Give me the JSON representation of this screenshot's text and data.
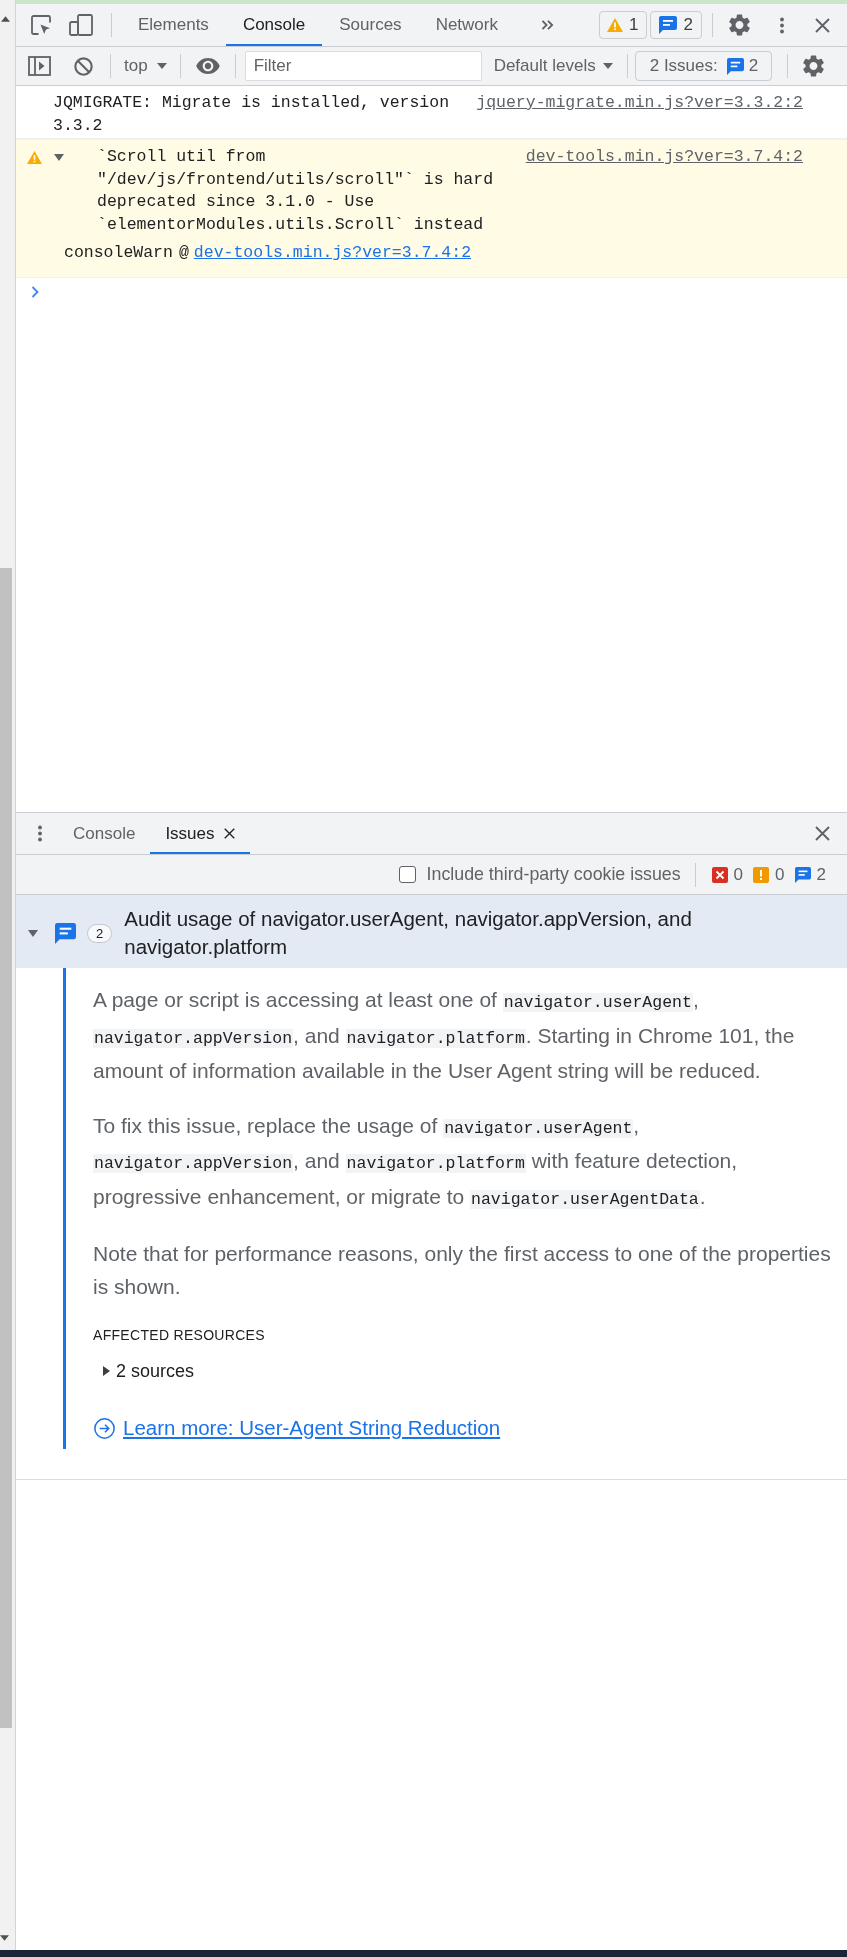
{
  "top_toolbar": {
    "tabs": [
      {
        "label": "Elements",
        "selected": false
      },
      {
        "label": "Console",
        "selected": true
      },
      {
        "label": "Sources",
        "selected": false
      },
      {
        "label": "Network",
        "selected": false
      }
    ],
    "warning_count": "1",
    "message_count": "2"
  },
  "console_toolbar": {
    "context": "top",
    "filter": {
      "placeholder": "Filter"
    },
    "levels": "Default levels",
    "issues_label": "2 Issues:",
    "issues_count": "2"
  },
  "messages": [
    {
      "kind": "log",
      "text": "JQMIGRATE: Migrate is installed, version 3.3.2",
      "source": "jquery-migrate.min.js?ver=3.3.2:2"
    },
    {
      "kind": "warning",
      "expanded": true,
      "text": "`Scroll util from \"/dev/js/frontend/utils/scroll\"` is hard deprecated since 3.1.0 - Use `elementorModules.utils.Scroll` instead",
      "source": "dev-tools.min.js?ver=3.7.4:2",
      "stack": [
        {
          "function": "consoleWarn",
          "separator": "@",
          "source": "dev-tools.min.js?ver=3.7.4:2"
        }
      ]
    }
  ],
  "drawer": {
    "tabs": [
      {
        "label": "Console",
        "selected": false,
        "closable": false
      },
      {
        "label": "Issues",
        "selected": true,
        "closable": true
      }
    ],
    "include_third_party": {
      "label": "Include third-party cookie issues",
      "checked": false
    },
    "counts": [
      {
        "kind": "error",
        "count": "0"
      },
      {
        "kind": "warning",
        "count": "0"
      },
      {
        "kind": "info",
        "count": "2"
      }
    ],
    "issues": [
      {
        "kind": "info",
        "count": "2",
        "title": "Audit usage of navigator.userAgent, navigator.appVersion, and navigator.platform",
        "expanded": true,
        "paragraphs": [
          {
            "segments": [
              {
                "kind": "text",
                "text": "A page or script is accessing at least one of "
              },
              {
                "kind": "code",
                "text": "navigator.userAgent"
              },
              {
                "kind": "text",
                "text": ", "
              },
              {
                "kind": "code",
                "text": "navigator.appVersion"
              },
              {
                "kind": "text",
                "text": ", and "
              },
              {
                "kind": "code",
                "text": "navigator.platform"
              },
              {
                "kind": "text",
                "text": ". Starting in Chrome 101, the amount of information available in the User Agent string will be reduced."
              }
            ]
          },
          {
            "segments": [
              {
                "kind": "text",
                "text": "To fix this issue, replace the usage of "
              },
              {
                "kind": "code",
                "text": "navigator.userAgent"
              },
              {
                "kind": "text",
                "text": ", "
              },
              {
                "kind": "code",
                "text": "navigator.appVersion"
              },
              {
                "kind": "text",
                "text": ", and "
              },
              {
                "kind": "code",
                "text": "navigator.platform"
              },
              {
                "kind": "text",
                "text": " with feature detection, progressive enhancement, or migrate to "
              },
              {
                "kind": "code",
                "text": "navigator.userAgentData"
              },
              {
                "kind": "text",
                "text": "."
              }
            ]
          },
          {
            "segments": [
              {
                "kind": "text",
                "text": "Note that for performance reasons, only the first access to one of the properties is shown."
              }
            ]
          }
        ],
        "affected_heading": "AFFECTED RESOURCES",
        "sources": {
          "label": "2 sources",
          "expanded": false
        },
        "link": "Learn more: User-Agent String Reduction"
      }
    ]
  }
}
